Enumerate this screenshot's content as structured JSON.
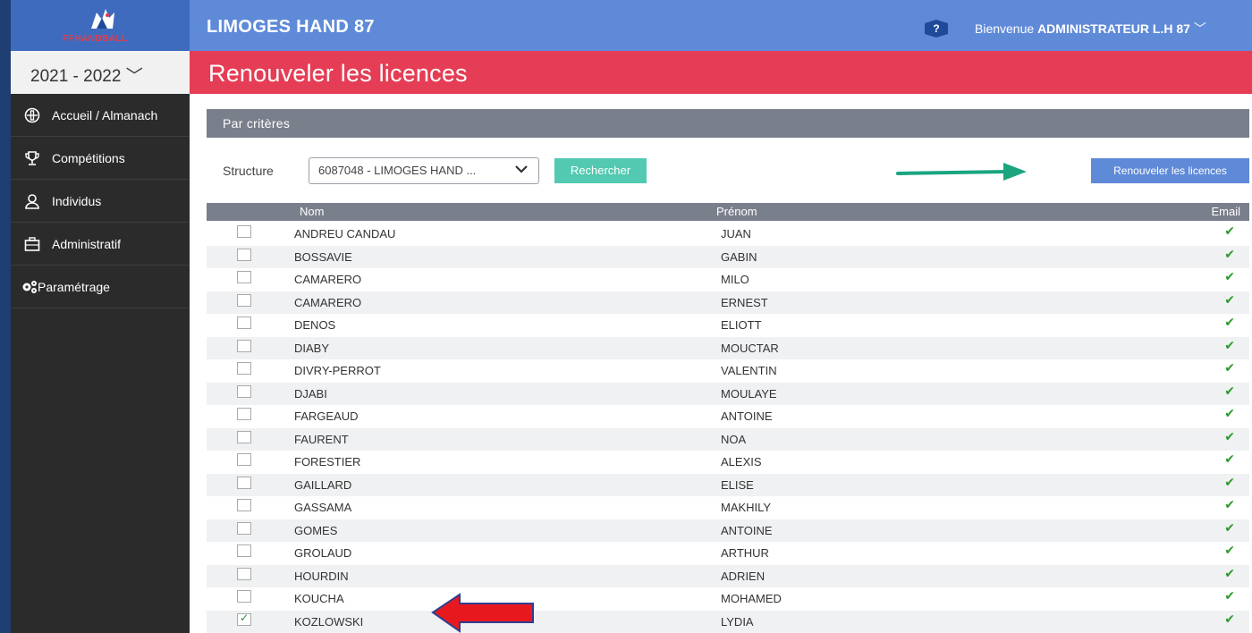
{
  "header": {
    "logo_text": "FFHANDBALL",
    "club_name": "LIMOGES HAND 87",
    "help_label": "?",
    "welcome_prefix": "Bienvenue ",
    "welcome_user": "ADMINISTRATEUR L.H 87",
    "welcome_chevron": "﹀"
  },
  "season": {
    "label": "2021 - 2022",
    "chevron": "﹀"
  },
  "page": {
    "title": "Renouveler les licences"
  },
  "sidebar": {
    "items": [
      {
        "label": "Accueil / Almanach",
        "icon": "almanach-icon"
      },
      {
        "label": "Compétitions",
        "icon": "trophy-icon"
      },
      {
        "label": "Individus",
        "icon": "user-icon"
      },
      {
        "label": "Administratif",
        "icon": "briefcase-icon"
      },
      {
        "label": "Paramétrage",
        "icon": "gears-icon"
      }
    ]
  },
  "criteria": {
    "title": "Par critères",
    "structure_label": "Structure",
    "structure_value": "6087048 - LIMOGES HAND ...",
    "search_button": "Rechercher",
    "renew_button": "Renouveler les licences"
  },
  "table": {
    "headers": {
      "nom": "Nom",
      "prenom": "Prénom",
      "email": "Email"
    },
    "rows": [
      {
        "nom": "ANDREU CANDAU",
        "prenom": "JUAN",
        "checked": false,
        "email": "✔"
      },
      {
        "nom": "BOSSAVIE",
        "prenom": "GABIN",
        "checked": false,
        "email": "✔"
      },
      {
        "nom": "CAMARERO",
        "prenom": "MILO",
        "checked": false,
        "email": "✔"
      },
      {
        "nom": "CAMARERO",
        "prenom": "ERNEST",
        "checked": false,
        "email": "✔"
      },
      {
        "nom": "DENOS",
        "prenom": "ELIOTT",
        "checked": false,
        "email": "✔"
      },
      {
        "nom": "DIABY",
        "prenom": "MOUCTAR",
        "checked": false,
        "email": "✔"
      },
      {
        "nom": "DIVRY-PERROT",
        "prenom": "VALENTIN",
        "checked": false,
        "email": "✔"
      },
      {
        "nom": "DJABI",
        "prenom": "MOULAYE",
        "checked": false,
        "email": "✔"
      },
      {
        "nom": "FARGEAUD",
        "prenom": "ANTOINE",
        "checked": false,
        "email": "✔"
      },
      {
        "nom": "FAURENT",
        "prenom": "NOA",
        "checked": false,
        "email": "✔"
      },
      {
        "nom": "FORESTIER",
        "prenom": "ALEXIS",
        "checked": false,
        "email": "✔"
      },
      {
        "nom": "GAILLARD",
        "prenom": "ELISE",
        "checked": false,
        "email": "✔"
      },
      {
        "nom": "GASSAMA",
        "prenom": "MAKHILY",
        "checked": false,
        "email": "✔"
      },
      {
        "nom": "GOMES",
        "prenom": "ANTOINE",
        "checked": false,
        "email": "✔"
      },
      {
        "nom": "GROLAUD",
        "prenom": "ARTHUR",
        "checked": false,
        "email": "✔"
      },
      {
        "nom": "HOURDIN",
        "prenom": "ADRIEN",
        "checked": false,
        "email": "✔"
      },
      {
        "nom": "KOUCHA",
        "prenom": "MOHAMED",
        "checked": false,
        "email": "✔"
      },
      {
        "nom": "KOZLOWSKI",
        "prenom": "LYDIA",
        "checked": true,
        "email": "✔"
      }
    ]
  },
  "colors": {
    "topbar": "#5f8ad8",
    "title_bar": "#e53d55",
    "sidebar": "#2b2b2b",
    "search_button": "#52c9b0",
    "renew_button": "#5f8ad8",
    "annotation_green_arrow": "#1aa57f",
    "annotation_red_arrow": "#e8191e"
  }
}
